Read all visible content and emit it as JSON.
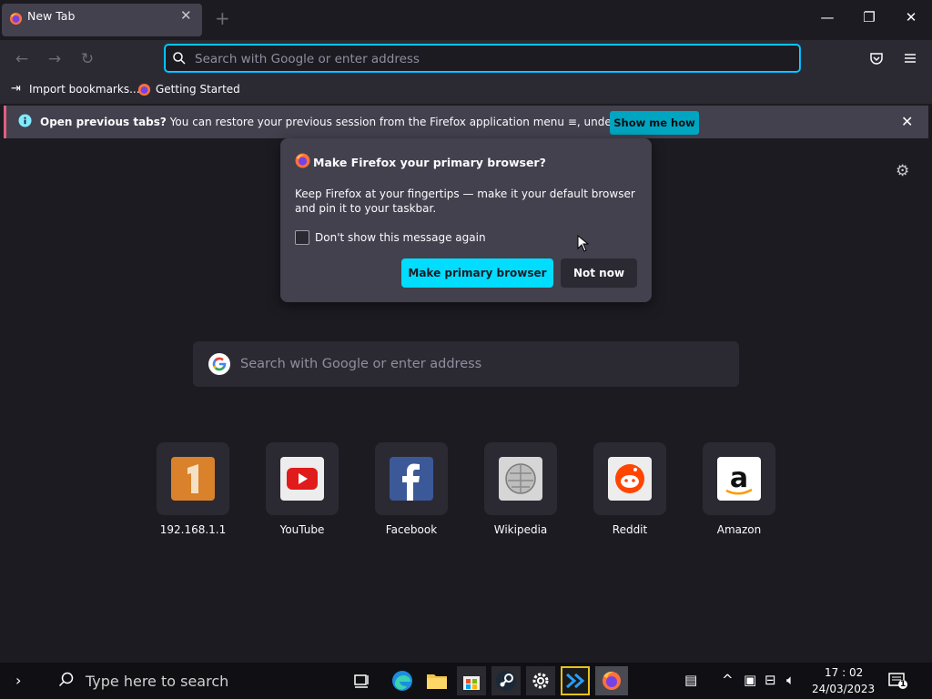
{
  "window": {
    "tab_title": "New Tab",
    "new_tab_symbol": "+"
  },
  "navbar": {
    "url_placeholder": "Search with Google or enter address"
  },
  "bookmarks": [
    {
      "label": "Import bookmarks...",
      "icon": "import-icon"
    },
    {
      "label": "Getting Started",
      "icon": "firefox-icon"
    }
  ],
  "notification": {
    "bold": "Open previous tabs?",
    "text": " You can restore your previous session from the Firefox application menu ",
    "text_after": ", under History.",
    "button": "Show me how"
  },
  "doorhanger": {
    "title": "Make Firefox your primary browser?",
    "body": "Keep Firefox at your fingertips — make it your default browser and pin it to your taskbar.",
    "checkbox_label": "Don't show this message again",
    "checkbox_checked": false,
    "primary_button": "Make primary browser",
    "secondary_button": "Not now"
  },
  "content_search": {
    "placeholder": "Search with Google or enter address"
  },
  "top_sites": [
    {
      "label": "192.168.1.1",
      "icon": "router-icon",
      "color": "#d9822b"
    },
    {
      "label": "YouTube",
      "icon": "youtube-icon",
      "color": "#ff0000"
    },
    {
      "label": "Facebook",
      "icon": "facebook-icon",
      "color": "#1877f2"
    },
    {
      "label": "Wikipedia",
      "icon": "wikipedia-icon",
      "color": "#cfcfcf"
    },
    {
      "label": "Reddit",
      "icon": "reddit-icon",
      "color": "#ff4500"
    },
    {
      "label": "Amazon",
      "icon": "amazon-icon",
      "color": "#ffffff"
    }
  ],
  "taskbar": {
    "search_placeholder": "Type here to search",
    "time": "17 : 02",
    "date": "24/03/2023",
    "notification_count": "1"
  },
  "colors": {
    "accent": "#00ddff",
    "background": "#1c1b22",
    "panel": "#42414d",
    "notification_bar": "#e0607e"
  }
}
